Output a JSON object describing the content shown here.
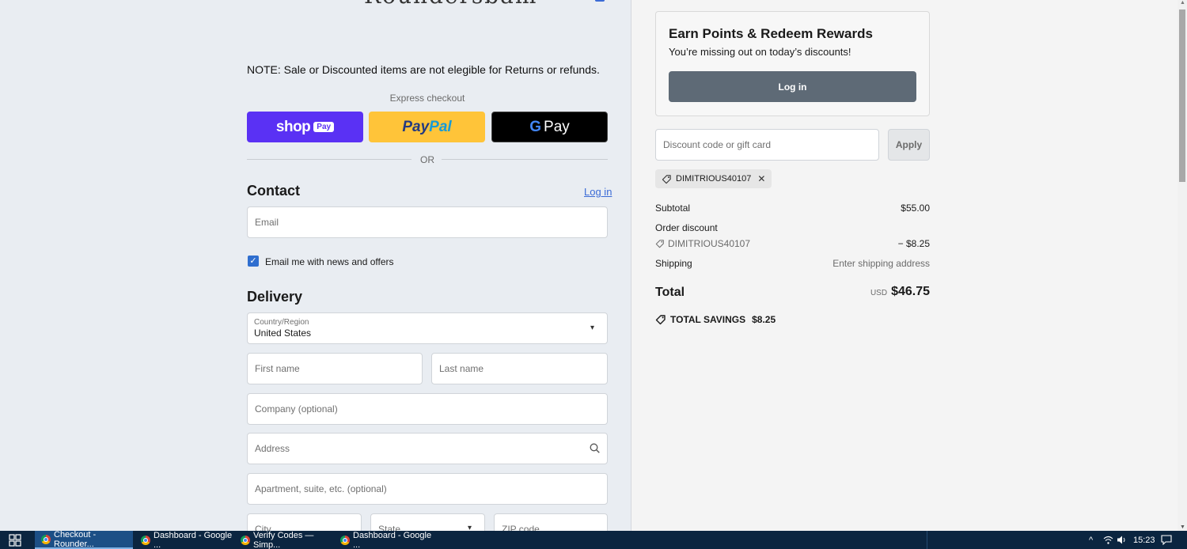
{
  "checkout": {
    "logo_text": "Roundersbam",
    "note": "NOTE: Sale or Discounted items are not elegible for Returns or refunds.",
    "express_checkout_label": "Express checkout",
    "shop_pay": {
      "word": "shop",
      "badge": "Pay"
    },
    "paypal": {
      "pay": "Pay",
      "pal": "Pal"
    },
    "gpay": {
      "g": "G",
      "word": "Pay"
    },
    "or_label": "OR"
  },
  "contact": {
    "title": "Contact",
    "login_link": "Log in",
    "email_placeholder": "Email",
    "newsletter_label": "Email me with news and offers",
    "newsletter_checked": true
  },
  "delivery": {
    "title": "Delivery",
    "country_label": "Country/Region",
    "country_value": "United States",
    "first_name_placeholder": "First name",
    "last_name_placeholder": "Last name",
    "company_placeholder": "Company (optional)",
    "address_placeholder": "Address",
    "apartment_placeholder": "Apartment, suite, etc. (optional)",
    "city_placeholder": "City",
    "state_placeholder": "State",
    "zip_placeholder": "ZIP code"
  },
  "rewards": {
    "title": "Earn Points & Redeem Rewards",
    "subtitle": "You’re missing out on today’s discounts!",
    "login_button": "Log in"
  },
  "discount": {
    "placeholder": "Discount code or gift card",
    "apply_label": "Apply",
    "applied_code": "DIMITRIOUS40107"
  },
  "summary": {
    "subtotal_label": "Subtotal",
    "subtotal_value": "$55.00",
    "order_discount_label": "Order discount",
    "discount_code": "DIMITRIOUS40107",
    "discount_value": "− $8.25",
    "shipping_label": "Shipping",
    "shipping_value": "Enter shipping address",
    "total_label": "Total",
    "total_currency": "USD",
    "total_value": "$46.75",
    "savings_label": "TOTAL SAVINGS",
    "savings_value": "$8.25"
  },
  "taskbar": {
    "tasks": [
      {
        "label": "Checkout - Rounder...",
        "active": true
      },
      {
        "label": "Dashboard - Google ...",
        "active": false
      },
      {
        "label": "Verify Codes — Simp...",
        "active": false
      },
      {
        "label": "Dashboard - Google ...",
        "active": false
      }
    ],
    "clock": "15:23"
  },
  "colors": {
    "shop_pay": "#5a31f4",
    "paypal": "#ffc439",
    "gpay": "#000000",
    "link": "#3b6bd6",
    "rewards_button": "#5e6a76",
    "taskbar": "#0b2540"
  }
}
